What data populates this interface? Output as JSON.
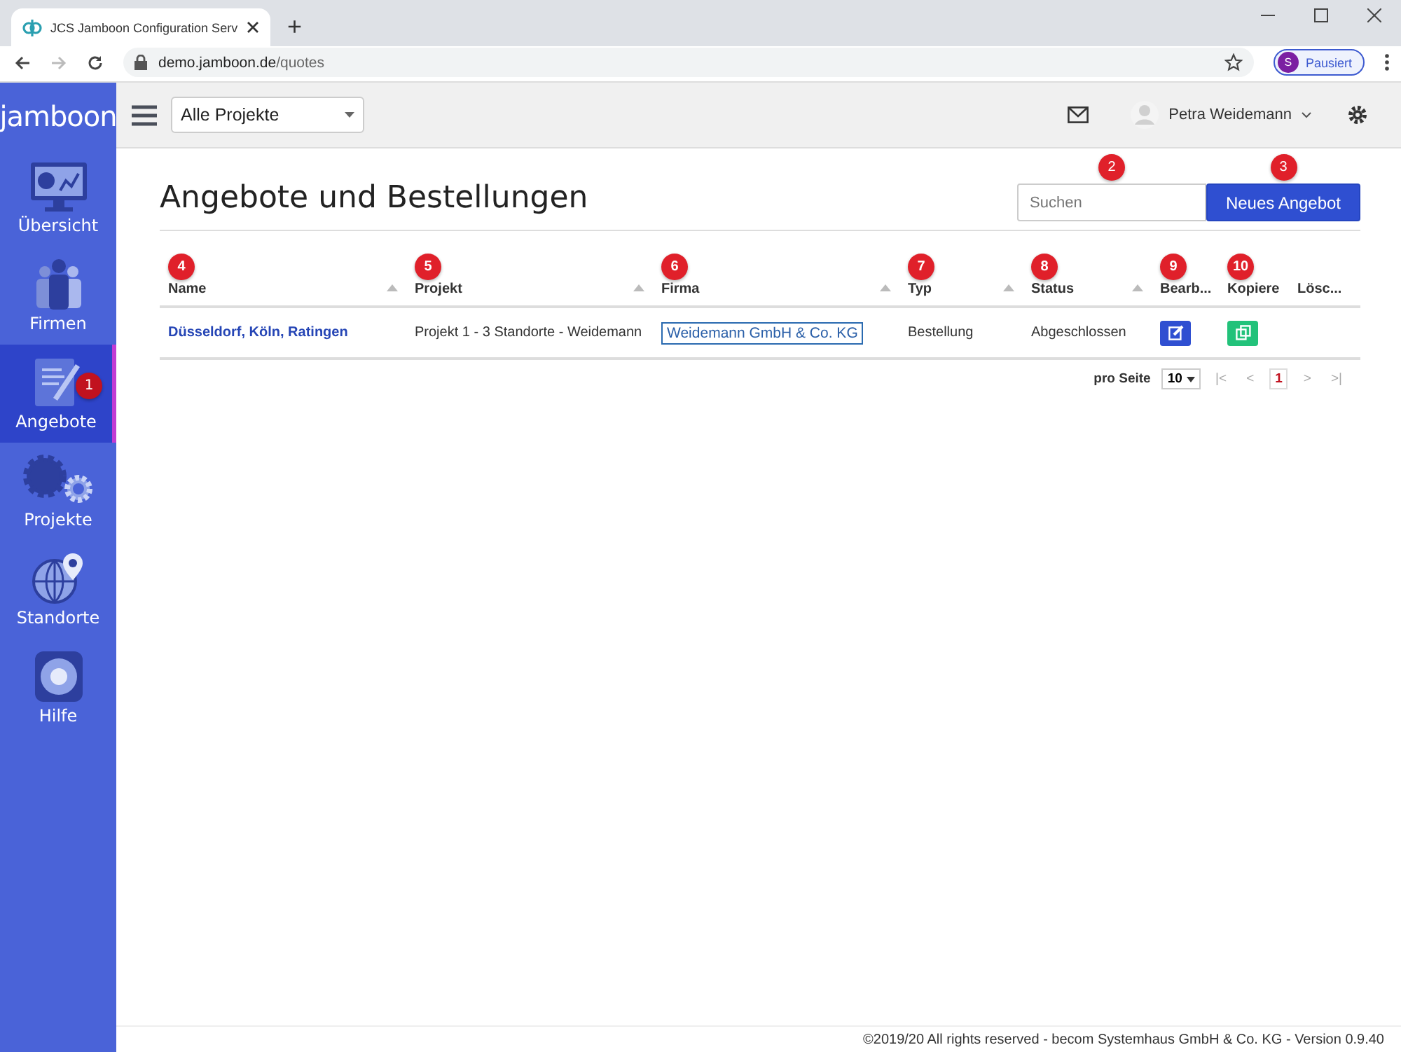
{
  "browser": {
    "tab_title": "JCS Jamboon Configuration Serv",
    "new_tab": "+",
    "url_host": "demo.jamboon.de",
    "url_path": "/quotes",
    "profile_initial": "S",
    "profile_label": "Pausiert"
  },
  "header": {
    "logo": "jamboon",
    "project_select": "Alle Projekte",
    "user": "Petra Weidemann"
  },
  "sidebar": {
    "items": [
      {
        "label": "Übersicht",
        "selected": false
      },
      {
        "label": "Firmen",
        "selected": false
      },
      {
        "label": "Angebote",
        "selected": true,
        "callout": "1"
      },
      {
        "label": "Projekte",
        "selected": false
      },
      {
        "label": "Standorte",
        "selected": false
      },
      {
        "label": "Hilfe",
        "selected": false
      }
    ]
  },
  "page": {
    "title": "Angebote und Bestellungen",
    "search": {
      "placeholder": "Suchen",
      "callout": "2"
    },
    "new_button": {
      "label": "Neues Angebot",
      "callout": "3"
    }
  },
  "table": {
    "columns": [
      {
        "label": "Name",
        "sortable": true,
        "callout": "4"
      },
      {
        "label": "Projekt",
        "sortable": true,
        "callout": "5"
      },
      {
        "label": "Firma",
        "sortable": true,
        "callout": "6"
      },
      {
        "label": "Typ",
        "sortable": true,
        "callout": "7"
      },
      {
        "label": "Status",
        "sortable": true,
        "callout": "8"
      },
      {
        "label": "Bearb...",
        "sortable": false,
        "callout": "9"
      },
      {
        "label": "Kopiere",
        "sortable": false,
        "callout": "10"
      },
      {
        "label": "Lösc...",
        "sortable": false
      }
    ],
    "rows": [
      {
        "name": "Düsseldorf, Köln, Ratingen",
        "project": "Projekt 1 - 3 Standorte - Weidemann",
        "company": "Weidemann GmbH & Co. KG",
        "type": "Bestellung",
        "status": "Abgeschlossen"
      }
    ]
  },
  "pagination": {
    "per_page_label": "pro Seite",
    "per_page": "10",
    "first": "|<",
    "prev": "<",
    "page": "1",
    "next": ">",
    "last": ">|"
  },
  "footer": "©2019/20 All rights reserved - becom Systemhaus GmbH & Co. KG - Version 0.9.40"
}
